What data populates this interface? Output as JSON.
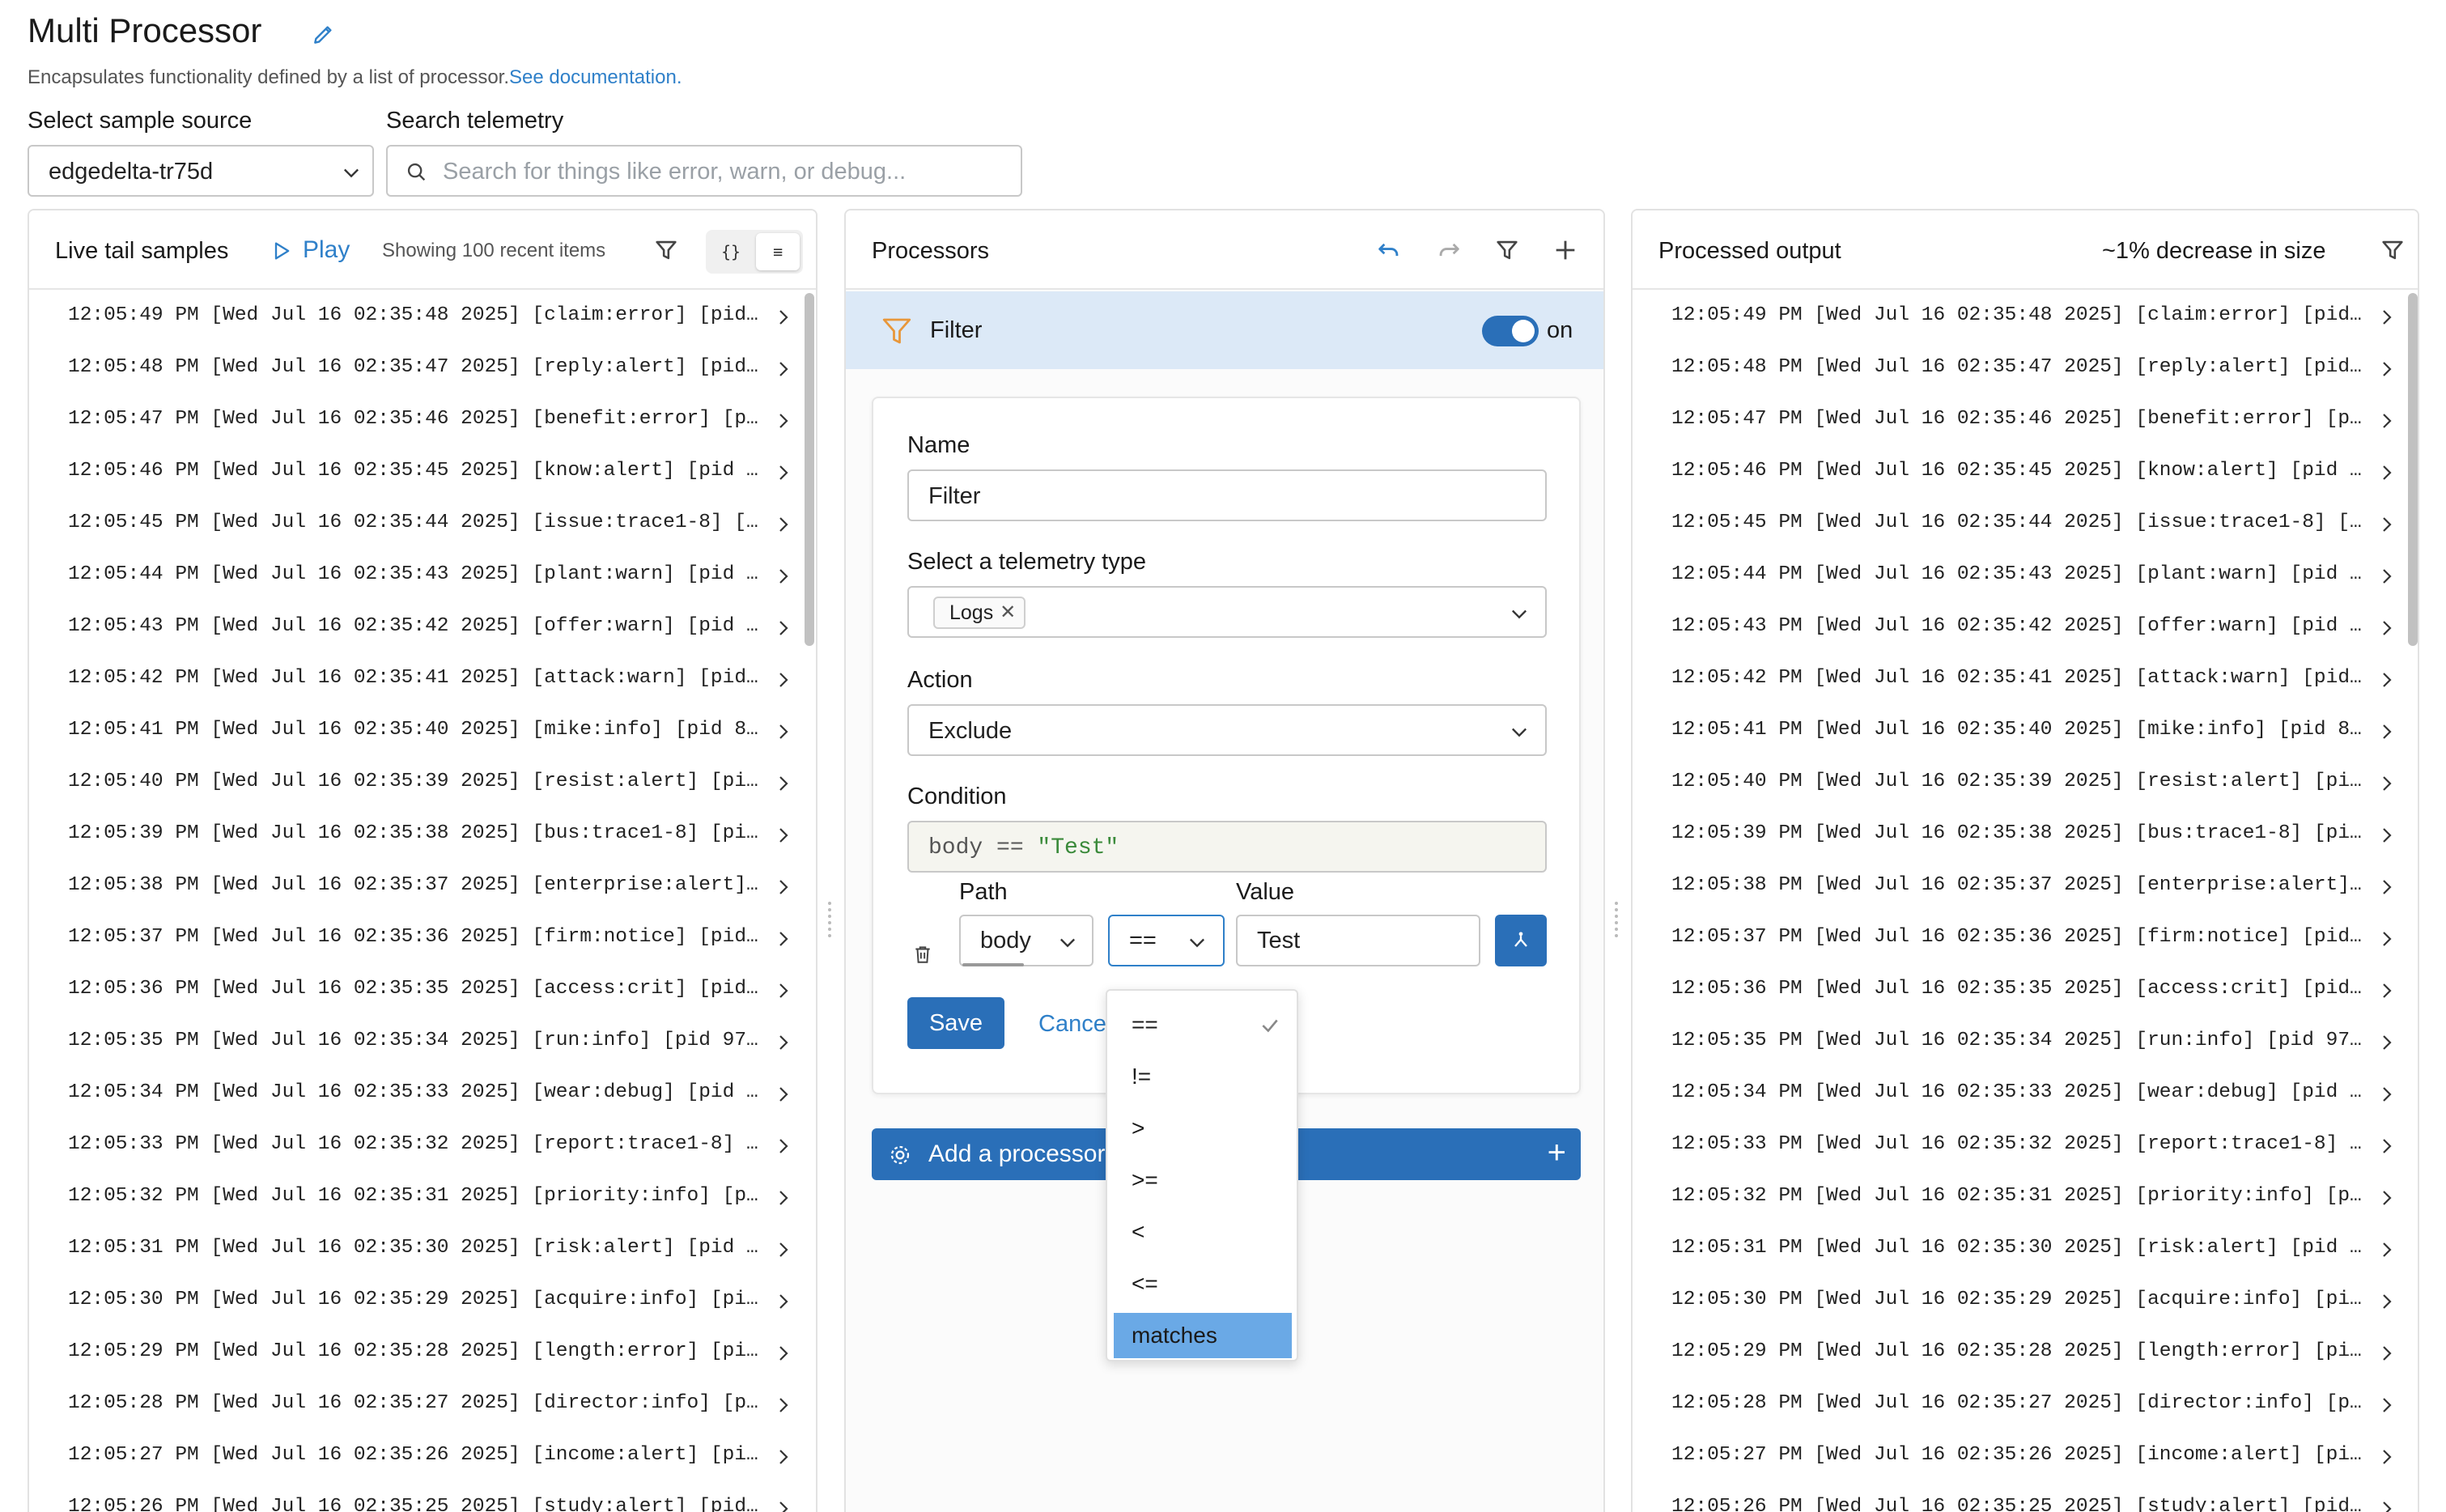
{
  "header": {
    "title": "Multi Processor",
    "description": "Encapsulates functionality defined by a list of processor.",
    "doc_link": "See documentation."
  },
  "source": {
    "label": "Select sample source",
    "value": "edgedelta-tr75d"
  },
  "search": {
    "label": "Search telemetry",
    "placeholder": "Search for things like error, warn, or debug..."
  },
  "live_tail": {
    "title": "Live tail samples",
    "play_label": "Play",
    "showing": "Showing 100 recent items",
    "view_json": "{}",
    "view_text": "≡",
    "rows": [
      "12:05:49 PM [Wed Jul 16 02:35:48 2025] [claim:error] [pid…",
      "12:05:48 PM [Wed Jul 16 02:35:47 2025] [reply:alert] [pid…",
      "12:05:47 PM [Wed Jul 16 02:35:46 2025] [benefit:error] [p…",
      "12:05:46 PM [Wed Jul 16 02:35:45 2025] [know:alert] [pid …",
      "12:05:45 PM [Wed Jul 16 02:35:44 2025] [issue:trace1-8] […",
      "12:05:44 PM [Wed Jul 16 02:35:43 2025] [plant:warn] [pid …",
      "12:05:43 PM [Wed Jul 16 02:35:42 2025] [offer:warn] [pid …",
      "12:05:42 PM [Wed Jul 16 02:35:41 2025] [attack:warn] [pid…",
      "12:05:41 PM [Wed Jul 16 02:35:40 2025] [mike:info] [pid 8…",
      "12:05:40 PM [Wed Jul 16 02:35:39 2025] [resist:alert] [pi…",
      "12:05:39 PM [Wed Jul 16 02:35:38 2025] [bus:trace1-8] [pi…",
      "12:05:38 PM [Wed Jul 16 02:35:37 2025] [enterprise:alert]…",
      "12:05:37 PM [Wed Jul 16 02:35:36 2025] [firm:notice] [pid…",
      "12:05:36 PM [Wed Jul 16 02:35:35 2025] [access:crit] [pid…",
      "12:05:35 PM [Wed Jul 16 02:35:34 2025] [run:info] [pid 97…",
      "12:05:34 PM [Wed Jul 16 02:35:33 2025] [wear:debug] [pid …",
      "12:05:33 PM [Wed Jul 16 02:35:32 2025] [report:trace1-8] …",
      "12:05:32 PM [Wed Jul 16 02:35:31 2025] [priority:info] [p…",
      "12:05:31 PM [Wed Jul 16 02:35:30 2025] [risk:alert] [pid …",
      "12:05:30 PM [Wed Jul 16 02:35:29 2025] [acquire:info] [pi…",
      "12:05:29 PM [Wed Jul 16 02:35:28 2025] [length:error] [pi…",
      "12:05:28 PM [Wed Jul 16 02:35:27 2025] [director:info] [p…",
      "12:05:27 PM [Wed Jul 16 02:35:26 2025] [income:alert] [pi…",
      "12:05:26 PM [Wed Jul 16 02:35:25 2025] [study:alert] [pid…"
    ]
  },
  "processors": {
    "title": "Processors",
    "filter_title": "Filter",
    "switch_label": "on",
    "form": {
      "name_label": "Name",
      "name_value": "Filter",
      "type_label": "Select a telemetry type",
      "type_tag": "Logs",
      "type_tag_remove": "✕",
      "action_label": "Action",
      "action_value": "Exclude",
      "condition_label": "Condition",
      "condition_prefix": "body == ",
      "condition_string": "\"Test\"",
      "path_label": "Path",
      "path_value": "body",
      "operator_value": "==",
      "value_label": "Value",
      "value_value": "Test",
      "save_label": "Save",
      "cancel_label": "Cancel"
    },
    "add_label": "Add a processor",
    "add_plus": "+",
    "operator_options": [
      "==",
      "!=",
      ">",
      ">=",
      "<",
      "<=",
      "matches"
    ],
    "operator_selected": "==",
    "operator_highlighted": "matches"
  },
  "output": {
    "title": "Processed output",
    "size_change": "~1% decrease in size"
  },
  "colors": {
    "accent": "#2a6fb8",
    "link": "#2f80c9",
    "highlight": "#dce9f7"
  }
}
